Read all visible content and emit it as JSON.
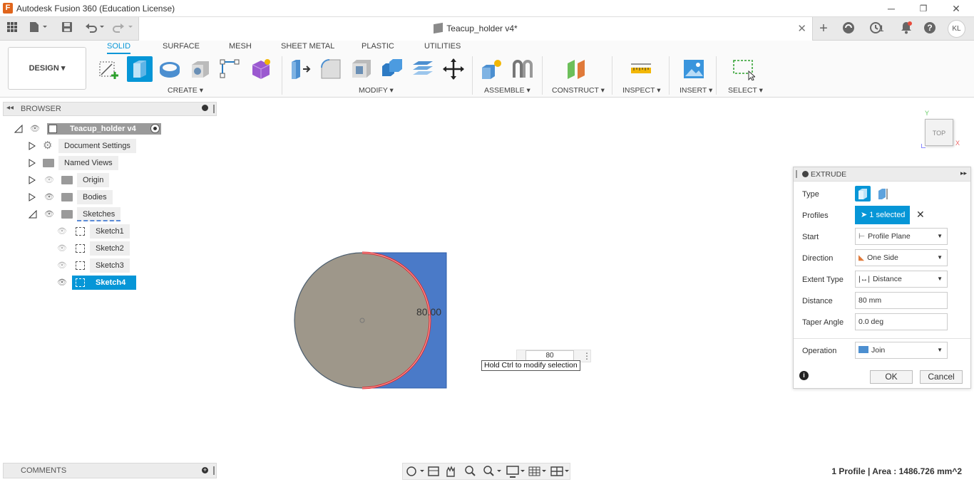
{
  "window": {
    "title": "Autodesk Fusion 360 (Education License)",
    "app_letter": "F"
  },
  "top_toolbar": {
    "notification_count": "1",
    "user_initials": "KL"
  },
  "document": {
    "title": "Teacup_holder v4*"
  },
  "workspace": {
    "selector_label": "DESIGN ▾"
  },
  "ribbon": {
    "tabs": [
      {
        "label": "SOLID"
      },
      {
        "label": "SURFACE"
      },
      {
        "label": "MESH"
      },
      {
        "label": "SHEET METAL"
      },
      {
        "label": "PLASTIC"
      },
      {
        "label": "UTILITIES"
      }
    ],
    "groups": {
      "create": "CREATE ▾",
      "modify": "MODIFY ▾",
      "assemble": "ASSEMBLE ▾",
      "construct": "CONSTRUCT ▾",
      "inspect": "INSPECT ▾",
      "insert": "INSERT ▾",
      "select": "SELECT ▾"
    }
  },
  "browser": {
    "title": "BROWSER",
    "root": "Teacup_holder v4",
    "items": [
      {
        "label": "Document Settings"
      },
      {
        "label": "Named Views"
      },
      {
        "label": "Origin"
      },
      {
        "label": "Bodies"
      },
      {
        "label": "Sketches"
      }
    ],
    "sketches": [
      {
        "label": "Sketch1"
      },
      {
        "label": "Sketch2"
      },
      {
        "label": "Sketch3"
      },
      {
        "label": "Sketch4"
      }
    ]
  },
  "viewport": {
    "dimension_text": "80.00",
    "input_value": "80",
    "tooltip": "Hold Ctrl to modify selection",
    "viewcube_face": "TOP",
    "axis_y": "Y",
    "axis_x": "X"
  },
  "extrude_dialog": {
    "title": "EXTRUDE",
    "rows": {
      "type": "Type",
      "profiles": "Profiles",
      "start": "Start",
      "direction": "Direction",
      "extent_type": "Extent Type",
      "distance": "Distance",
      "taper_angle": "Taper Angle",
      "operation": "Operation"
    },
    "values": {
      "profiles": "1 selected",
      "start": "Profile Plane",
      "direction": "One Side",
      "extent_type": "Distance",
      "distance": "80 mm",
      "taper_angle": "0.0 deg",
      "operation": "Join"
    },
    "ok": "OK",
    "cancel": "Cancel"
  },
  "comments": {
    "title": "COMMENTS"
  },
  "status": {
    "text": "1 Profile | Area : 1486.726 mm^2"
  },
  "colors": {
    "accent": "#0696d7",
    "profile_blue": "#4a7ac8",
    "body_gray": "#9e978a"
  }
}
